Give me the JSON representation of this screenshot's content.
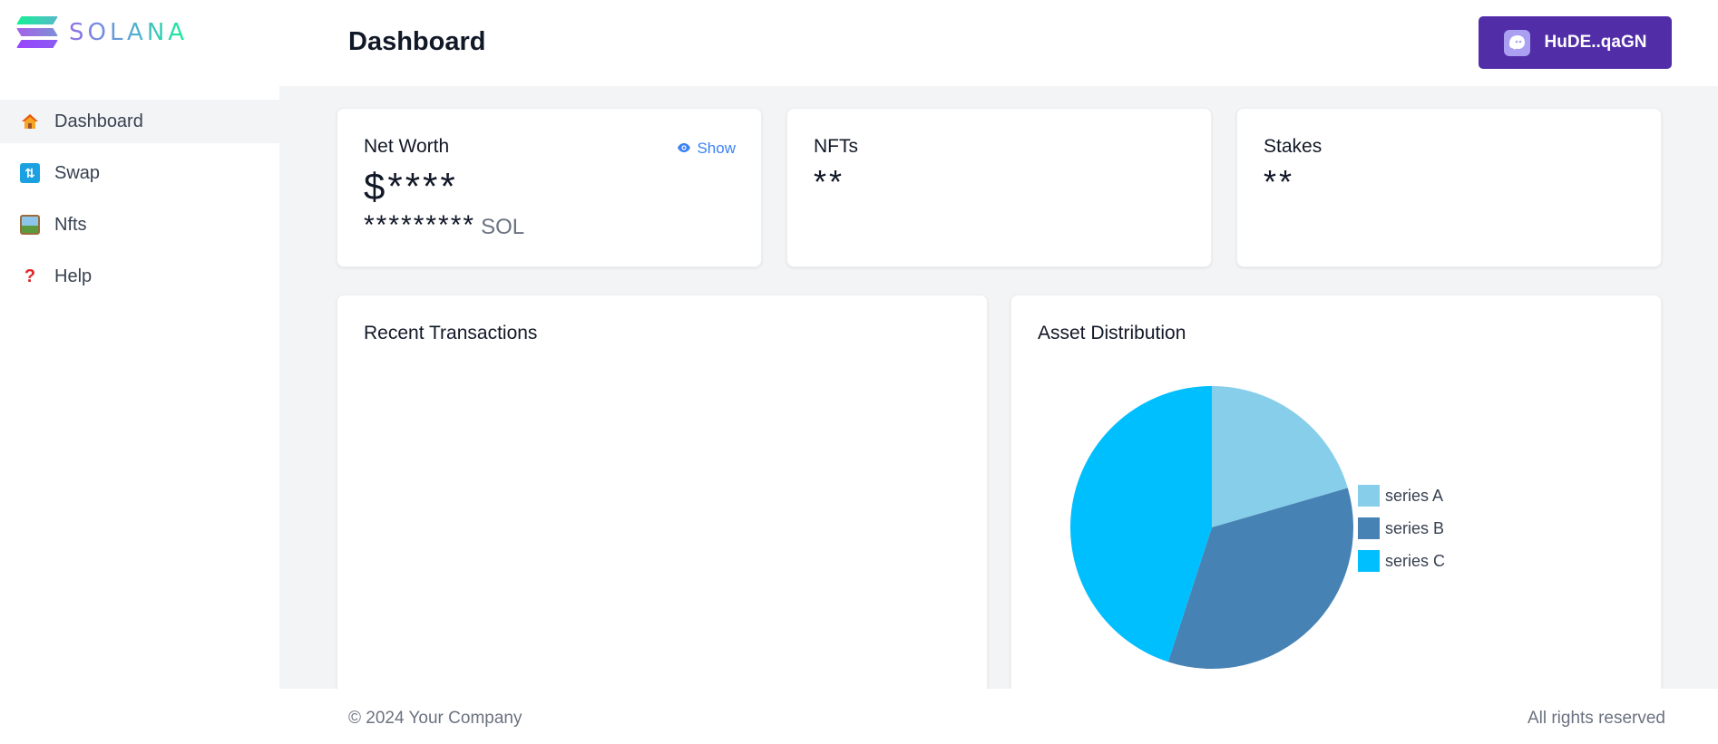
{
  "brand": {
    "logo_text": "SOLANA"
  },
  "sidebar": {
    "items": [
      {
        "label": "Dashboard",
        "icon": "home-icon",
        "active": true
      },
      {
        "label": "Swap",
        "icon": "swap-icon",
        "active": false
      },
      {
        "label": "Nfts",
        "icon": "picture-icon",
        "active": false
      },
      {
        "label": "Help",
        "icon": "question-icon",
        "active": false
      }
    ]
  },
  "header": {
    "title": "Dashboard",
    "wallet_label": "HuDE..qaGN",
    "wallet_icon": "phantom-ghost-icon"
  },
  "cards": {
    "net_worth": {
      "title": "Net Worth",
      "value": "$****",
      "sol_value": "*********",
      "sol_unit": "SOL",
      "show_label": "Show"
    },
    "nfts": {
      "title": "NFTs",
      "value": "**"
    },
    "stakes": {
      "title": "Stakes",
      "value": "**"
    }
  },
  "recent_transactions": {
    "title": "Recent Transactions"
  },
  "asset_distribution": {
    "title": "Asset Distribution",
    "chart_data": {
      "type": "pie",
      "categories": [
        "series A",
        "series B",
        "series C"
      ],
      "values": [
        20.5,
        34.5,
        45
      ],
      "colors": [
        "#87ceeb",
        "#4682b4",
        "#00bfff"
      ],
      "legend": "right"
    }
  },
  "footer": {
    "copyright": "© 2024 Your Company",
    "rights": "All rights reserved"
  },
  "colors": {
    "accent": "#512da8",
    "link": "#3b82f6",
    "background": "#f3f4f6"
  }
}
